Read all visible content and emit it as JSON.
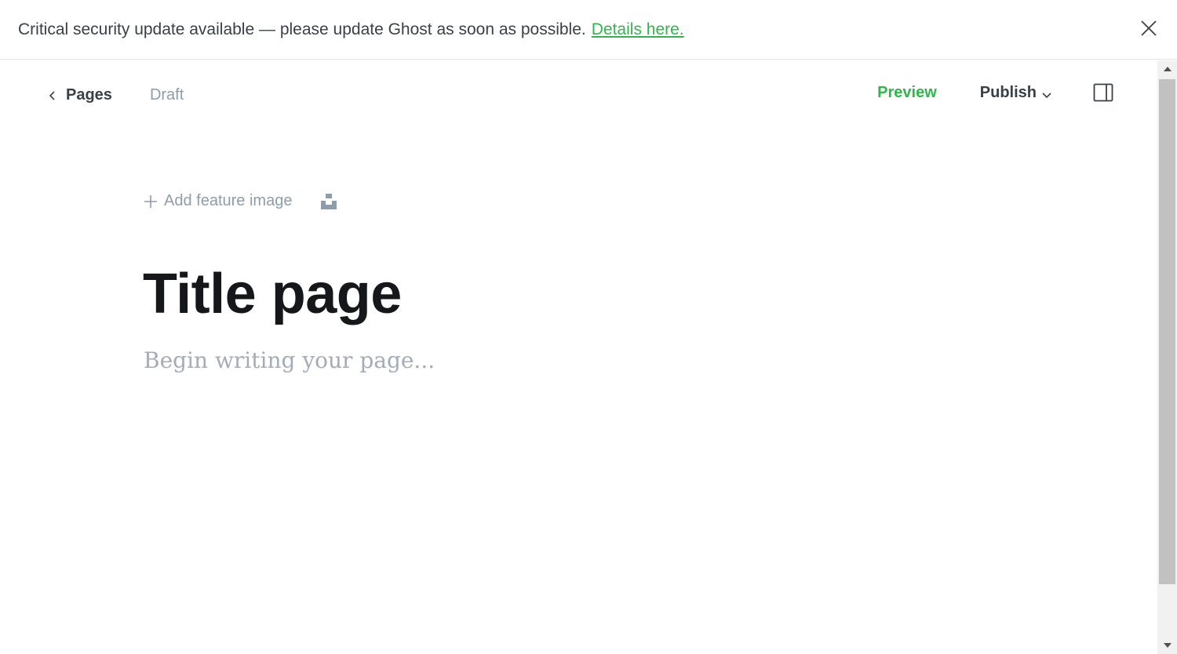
{
  "banner": {
    "message": "Critical security update available — please update Ghost as soon as possible.",
    "link_label": "Details here.",
    "close_icon": "close-icon"
  },
  "editor_header": {
    "back_label": "Pages",
    "back_icon": "chevron-left-icon",
    "status": "Draft",
    "preview_label": "Preview",
    "publish_label": "Publish",
    "publish_icon": "chevron-down-icon",
    "settings_icon": "sidebar-toggle-icon"
  },
  "feature_image": {
    "add_label": "Add feature image",
    "add_icon": "plus-icon",
    "unsplash_icon": "unsplash-icon"
  },
  "content": {
    "title": "Title page",
    "body_placeholder": "Begin writing your page..."
  },
  "colors": {
    "accent_green": "#30b64b",
    "text_dark": "#15171a",
    "text_muted": "#8e9cac",
    "placeholder": "#a3acb8"
  }
}
